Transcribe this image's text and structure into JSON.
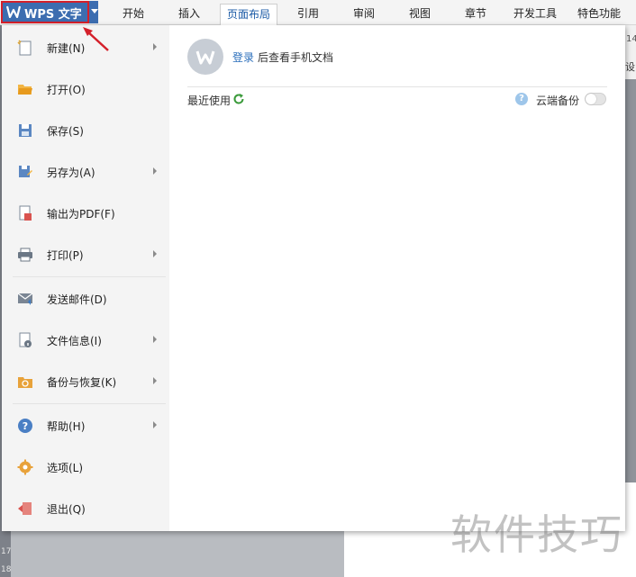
{
  "app": {
    "wps_button_label": "WPS 文字"
  },
  "ribbon": {
    "tabs": [
      {
        "label": "开始"
      },
      {
        "label": "插入"
      },
      {
        "label": "页面布局"
      },
      {
        "label": "引用"
      },
      {
        "label": "审阅"
      },
      {
        "label": "视图"
      },
      {
        "label": "章节"
      },
      {
        "label": "开发工具"
      },
      {
        "label": "特色功能"
      }
    ],
    "active_tab": "页面布局"
  },
  "file_menu": {
    "items": [
      {
        "label": "新建(N)",
        "icon": "new-document-icon",
        "has_submenu": true
      },
      {
        "label": "打开(O)",
        "icon": "open-folder-icon",
        "has_submenu": false
      },
      {
        "label": "保存(S)",
        "icon": "save-icon",
        "has_submenu": false
      },
      {
        "label": "另存为(A)",
        "icon": "save-as-icon",
        "has_submenu": true
      },
      {
        "label": "输出为PDF(F)",
        "icon": "export-pdf-icon",
        "has_submenu": false
      },
      {
        "label": "打印(P)",
        "icon": "printer-icon",
        "has_submenu": true
      },
      {
        "label": "发送邮件(D)",
        "icon": "mail-icon",
        "has_submenu": false
      },
      {
        "label": "文件信息(I)",
        "icon": "file-info-icon",
        "has_submenu": true
      },
      {
        "label": "备份与恢复(K)",
        "icon": "backup-restore-icon",
        "has_submenu": true
      },
      {
        "label": "帮助(H)",
        "icon": "help-icon",
        "has_submenu": true
      },
      {
        "label": "选项(L)",
        "icon": "gear-icon",
        "has_submenu": false
      },
      {
        "label": "退出(Q)",
        "icon": "exit-icon",
        "has_submenu": false
      }
    ]
  },
  "account_panel": {
    "login_link": "登录",
    "login_suffix": "后查看手机文档",
    "recent_label": "最近使用",
    "cloud_backup_label": "云端备份",
    "cloud_backup_enabled": false,
    "help_glyph": "?"
  },
  "document": {
    "ruler_numbers": [
      "17",
      "18"
    ],
    "right_peek_label": "设",
    "right_peek_number": "14"
  },
  "watermark": "软件技巧",
  "colors": {
    "wps_button": "#3c6db0",
    "highlight_frame": "#d4202a",
    "link": "#2a6ebb",
    "active_tab_text": "#1a5aa6"
  }
}
